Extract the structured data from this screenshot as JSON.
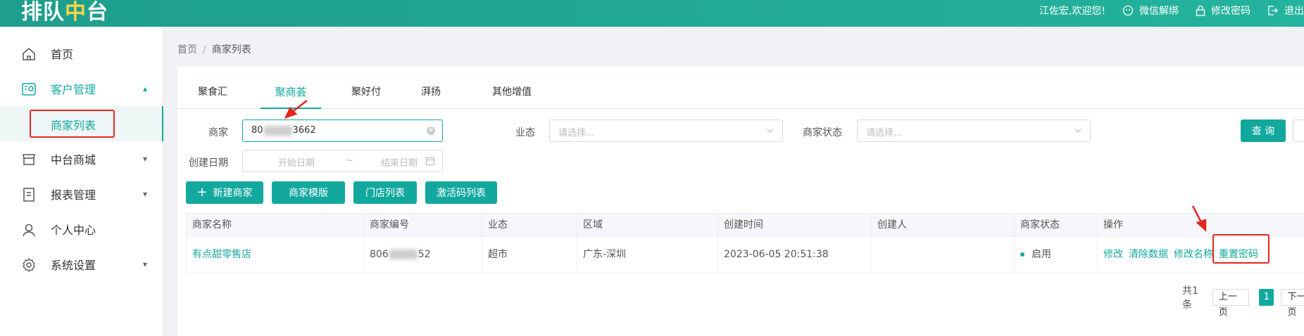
{
  "header": {
    "logo_prefix": "排队",
    "logo_highlight": "中",
    "logo_suffix": "台",
    "welcome": "江佐宏,欢迎您!",
    "wechat_unbind": "微信解绑",
    "change_password": "修改密码",
    "logout": "退出"
  },
  "sidebar": {
    "items": [
      {
        "label": "首页",
        "icon": "home-icon"
      },
      {
        "label": "客户管理",
        "icon": "customer-icon"
      },
      {
        "label": "商家列表"
      },
      {
        "label": "中台商城",
        "icon": "shop-icon"
      },
      {
        "label": "报表管理",
        "icon": "report-icon"
      },
      {
        "label": "个人中心",
        "icon": "user-icon"
      },
      {
        "label": "系统设置",
        "icon": "settings-icon"
      }
    ]
  },
  "breadcrumb": {
    "home": "首页",
    "separator": "/",
    "current": "商家列表"
  },
  "tabs": [
    "聚食汇",
    "聚商荟",
    "聚好付",
    "湃扬",
    "其他增值"
  ],
  "filters": {
    "merchant_label": "商家",
    "merchant_value_prefix": "80",
    "merchant_value_suffix": "3662",
    "business_label": "业态",
    "business_placeholder": "请选择...",
    "status_label": "商家状态",
    "status_placeholder": "请选择...",
    "created_label": "创建日期",
    "start_placeholder": "开始日期",
    "range_sep": "~",
    "end_placeholder": "结束日期",
    "query_button": "查 询"
  },
  "actions": {
    "new_merchant": "新建商家",
    "merchant_template": "商家模版",
    "store_list": "门店列表",
    "activation_list": "激活码列表"
  },
  "table": {
    "columns": [
      "商家名称",
      "商家编号",
      "业态",
      "区域",
      "创建时间",
      "创建人",
      "商家状态",
      "操作"
    ],
    "rows": [
      {
        "name": "有点甜零售店",
        "code_prefix": "806",
        "code_suffix": "52",
        "business": "超市",
        "region": "广东-深圳",
        "created_at": "2023-06-05 20:51:38",
        "creator": "",
        "status": "启用",
        "ops": [
          "修改",
          "清除数据",
          "修改名称",
          "重置密码"
        ]
      }
    ]
  },
  "pagination": {
    "total": "共1条",
    "prev": "上一页",
    "page": "1",
    "next": "下一页"
  },
  "colors": {
    "primary": "#13a89e",
    "header": "#1fa592",
    "highlight": "#e5261f"
  }
}
